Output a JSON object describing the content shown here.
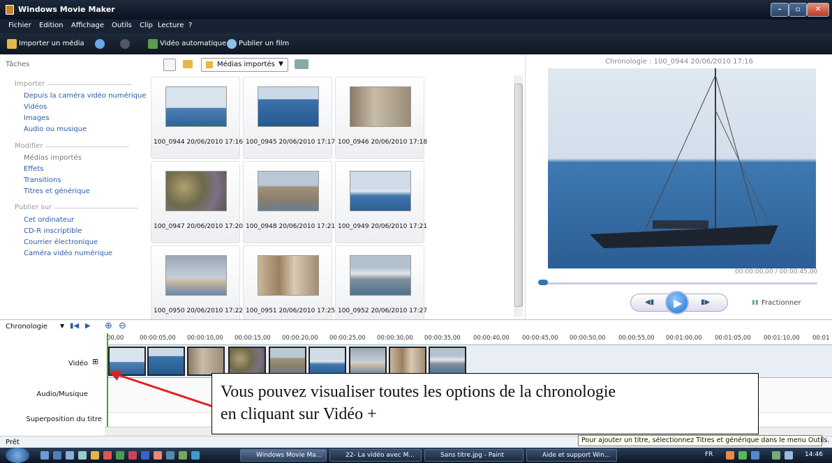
{
  "window": {
    "title": "Windows Movie Maker",
    "min_glyph": "–",
    "max_glyph": "▫",
    "close_glyph": "✕"
  },
  "menu": [
    "Fichier",
    "Edition",
    "Affichage",
    "Outils",
    "Clip",
    "Lecture",
    "?"
  ],
  "toolbar": {
    "import": "Importer un média",
    "auto_video": "Vidéo automatique",
    "publish": "Publier un film"
  },
  "tasks": {
    "title": "Tâches",
    "import_header": "Importer",
    "import_links": [
      "Depuis la caméra vidéo numérique",
      "Vidéos",
      "Images",
      "Audio ou musique"
    ],
    "edit_header": "Modifier",
    "edit_links": [
      "Médias importés",
      "Effets",
      "Transitions",
      "Titres et générique"
    ],
    "publish_header": "Publier sur",
    "publish_links": [
      "Cet ordinateur",
      "CD-R inscriptible",
      "Courrier électronique",
      "Caméra vidéo numérique"
    ]
  },
  "collection": {
    "selected": "Médias importés"
  },
  "media": [
    "100_0944 20/06/2010 17:16",
    "100_0945 20/06/2010 17:17",
    "100_0946 20/06/2010 17:18",
    "100_0947 20/06/2010 17:20",
    "100_0948 20/06/2010 17:21",
    "100_0949 20/06/2010 17:21",
    "100_0950 20/06/2010 17:22",
    "100_0951 20/06/2010 17:25",
    "100_0952 20/06/2010 17:27"
  ],
  "preview": {
    "title": "Chronologie : 100_0944 20/06/2010 17:16",
    "time": "00:00:00,00 / 00:00:45,00",
    "split": "Fractionner"
  },
  "timeline": {
    "label": "Chronologie",
    "ruler": [
      "00,00",
      "00:00:05,00",
      "00:00:10,00",
      "00:00:15,00",
      "00:00:20,00",
      "00:00:25,00",
      "00:00:30,00",
      "00:00:35,00",
      "00:00:40,00",
      "00:00:45,00",
      "00:00:50,00",
      "00:00:55,00",
      "00:01:00,00",
      "00:01:05,00",
      "00:01:10,00",
      "00:01"
    ],
    "tracks": {
      "video": "Vidéo",
      "audio": "Audio/Musique",
      "title": "Superposition du titre"
    }
  },
  "status": {
    "text": "Prêt",
    "tooltip": "Pour ajouter un titre, sélectionnez Titres et générique dans le menu Outils."
  },
  "callout": {
    "line1": "Vous pouvez visualiser toutes les options de la chronologie",
    "line2": "en cliquant sur Vidéo +"
  },
  "taskbar": {
    "tasks": [
      "Windows Movie Ma...",
      "22- La vidéo avec M...",
      "Sans titre.jpg - Paint",
      "Aide et support Win..."
    ],
    "lang": "FR",
    "clock": "14:46"
  },
  "colors": {
    "accent": "#2a5ca8",
    "callout_arrow": "#e0201f"
  }
}
